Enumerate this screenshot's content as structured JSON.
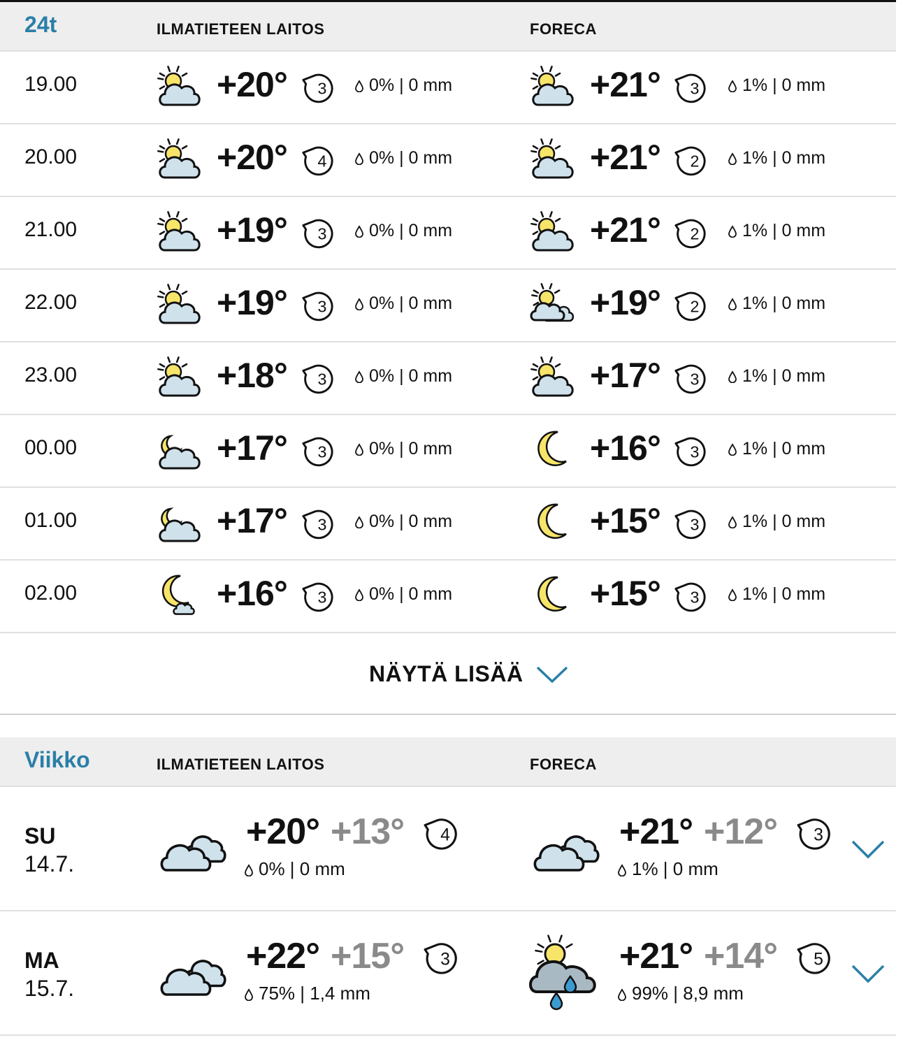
{
  "hourly": {
    "title": "24t",
    "source1": "ILMATIETEEN LAITOS",
    "source2": "FORECA",
    "rows": [
      {
        "time": "19.00",
        "il": {
          "icon": "sun-behind-cloud-icon",
          "temp": "+20°",
          "wind": "3",
          "wind_dir": 0,
          "precip": "0% | 0 mm"
        },
        "fc": {
          "icon": "sun-behind-cloud-icon",
          "temp": "+21°",
          "wind": "3",
          "wind_dir": 0,
          "precip": "1% | 0 mm"
        }
      },
      {
        "time": "20.00",
        "il": {
          "icon": "sun-behind-cloud-icon",
          "temp": "+20°",
          "wind": "4",
          "wind_dir": 0,
          "precip": "0% | 0 mm"
        },
        "fc": {
          "icon": "sun-behind-cloud-icon",
          "temp": "+21°",
          "wind": "2",
          "wind_dir": 0,
          "precip": "1% | 0 mm"
        }
      },
      {
        "time": "21.00",
        "il": {
          "icon": "sun-behind-cloud-icon",
          "temp": "+19°",
          "wind": "3",
          "wind_dir": 0,
          "precip": "0% | 0 mm"
        },
        "fc": {
          "icon": "sun-behind-cloud-icon",
          "temp": "+21°",
          "wind": "2",
          "wind_dir": 0,
          "precip": "1% | 0 mm"
        }
      },
      {
        "time": "22.00",
        "il": {
          "icon": "sun-behind-cloud-icon",
          "temp": "+19°",
          "wind": "3",
          "wind_dir": 0,
          "precip": "0% | 0 mm"
        },
        "fc": {
          "icon": "sun-behind-clouds-icon",
          "temp": "+19°",
          "wind": "2",
          "wind_dir": 0,
          "precip": "1% | 0 mm"
        }
      },
      {
        "time": "23.00",
        "il": {
          "icon": "sun-behind-cloud-icon",
          "temp": "+18°",
          "wind": "3",
          "wind_dir": 0,
          "precip": "0% | 0 mm"
        },
        "fc": {
          "icon": "sun-behind-cloud-icon",
          "temp": "+17°",
          "wind": "3",
          "wind_dir": 0,
          "precip": "1% | 0 mm"
        }
      },
      {
        "time": "00.00",
        "il": {
          "icon": "moon-behind-cloud-icon",
          "temp": "+17°",
          "wind": "3",
          "wind_dir": 0,
          "precip": "0% | 0 mm"
        },
        "fc": {
          "icon": "moon-icon",
          "temp": "+16°",
          "wind": "3",
          "wind_dir": 0,
          "precip": "1% | 0 mm"
        }
      },
      {
        "time": "01.00",
        "il": {
          "icon": "moon-behind-cloud-icon",
          "temp": "+17°",
          "wind": "3",
          "wind_dir": 0,
          "precip": "0% | 0 mm"
        },
        "fc": {
          "icon": "moon-icon",
          "temp": "+15°",
          "wind": "3",
          "wind_dir": 0,
          "precip": "1% | 0 mm"
        }
      },
      {
        "time": "02.00",
        "il": {
          "icon": "moon-small-cloud-icon",
          "temp": "+16°",
          "wind": "3",
          "wind_dir": 0,
          "precip": "0% | 0 mm"
        },
        "fc": {
          "icon": "moon-icon",
          "temp": "+15°",
          "wind": "3",
          "wind_dir": 0,
          "precip": "1% | 0 mm"
        }
      }
    ],
    "show_more_label": "NÄYTÄ LISÄÄ"
  },
  "weekly": {
    "title": "Viikko",
    "source1": "ILMATIETEEN LAITOS",
    "source2": "FORECA",
    "rows": [
      {
        "day": "SU",
        "date": "14.7.",
        "il": {
          "icon": "cloudy-icon",
          "high": "+20°",
          "low": "+13°",
          "wind": "4",
          "wind_dir": 0,
          "precip": "0% | 0 mm"
        },
        "fc": {
          "icon": "cloudy-icon",
          "high": "+21°",
          "low": "+12°",
          "wind": "3",
          "wind_dir": 0,
          "precip": "1% | 0 mm"
        }
      },
      {
        "day": "MA",
        "date": "15.7.",
        "il": {
          "icon": "cloudy-icon",
          "high": "+22°",
          "low": "+15°",
          "wind": "3",
          "wind_dir": 0,
          "precip": "75% | 1,4 mm"
        },
        "fc": {
          "icon": "sun-rain-cloud-icon",
          "high": "+21°",
          "low": "+14°",
          "wind": "5",
          "wind_dir": 0,
          "precip": "99% | 8,9 mm"
        }
      }
    ]
  },
  "colors": {
    "accent": "#2a7fa8",
    "cloud": "#cfe2ec",
    "dark_cloud": "#a9b9c3",
    "sun": "#f7e56a",
    "low_temp": "#8a8a8a",
    "rain": "#3b9bd1"
  }
}
